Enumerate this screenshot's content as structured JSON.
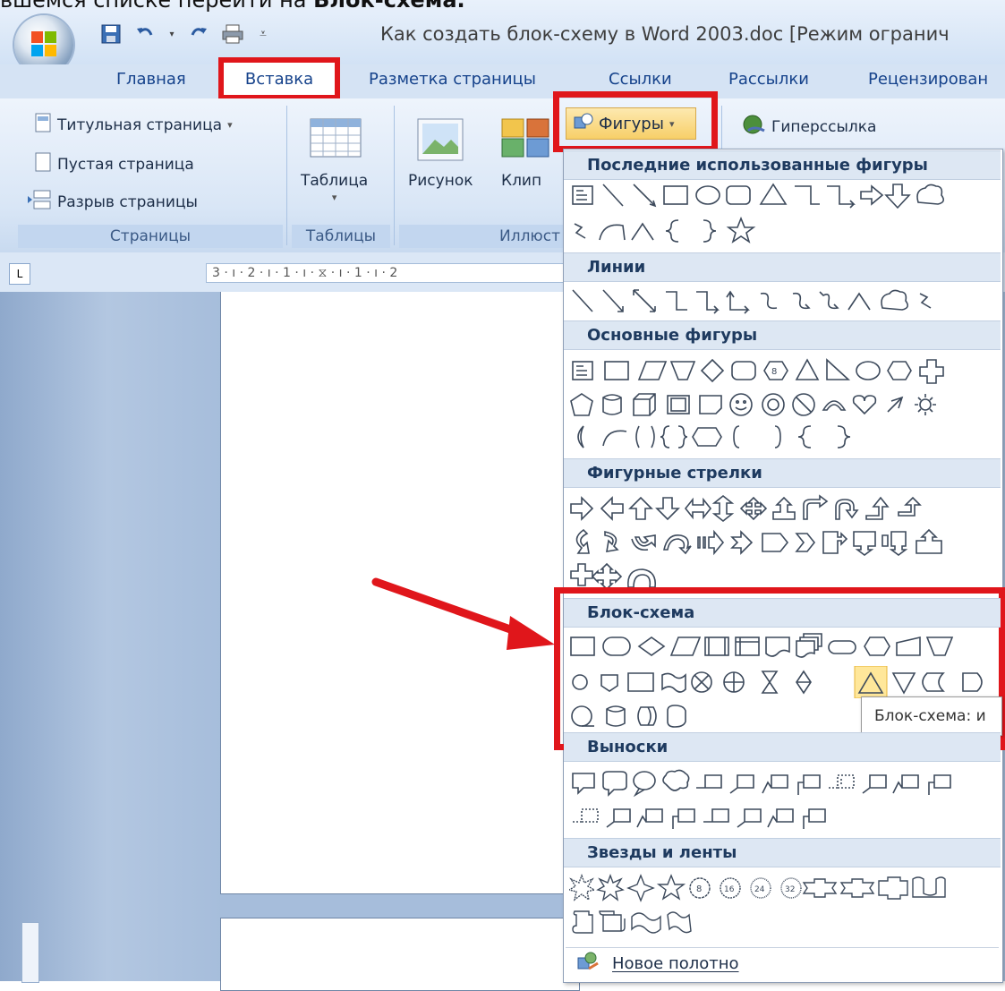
{
  "caption": {
    "prefix": "вшемся списке перейти на ",
    "bold": "Блок-схема."
  },
  "window": {
    "title": "Как создать блок-схему в Word 2003.doc [Режим огранич"
  },
  "quick_access": [
    "save-icon",
    "undo-icon",
    "redo-icon",
    "print-icon",
    "customize-icon"
  ],
  "tabs": [
    "Главная",
    "Вставка",
    "Разметка страницы",
    "Ссылки",
    "Рассылки",
    "Рецензирован"
  ],
  "ribbon": {
    "pages": {
      "cover": "Титульная страница",
      "blank": "Пустая страница",
      "break": "Разрыв страницы",
      "label": "Страницы"
    },
    "tables": {
      "table": "Таблица",
      "label": "Таблицы"
    },
    "illustrations": {
      "picture": "Рисунок",
      "clip": "Клип",
      "shapes": "Фигуры",
      "label": "Иллюст"
    },
    "links": {
      "hyperlink": "Гиперссылка"
    }
  },
  "ruler": {
    "text": "3 · ı · 2 · ı · 1 · ı · ⧖ · ı · 1 · ı · 2"
  },
  "dropdown": {
    "sections": {
      "recent": "Последние использованные фигуры",
      "lines": "Линии",
      "basic": "Основные фигуры",
      "arrows": "Фигурные стрелки",
      "flowchart": "Блок-схема",
      "callouts": "Выноски",
      "stars": "Звезды и ленты"
    },
    "tooltip": "Блок-схема: и",
    "new_canvas": "Новое полотно"
  },
  "colors": {
    "highlight_red": "#e0161b",
    "accent_blue": "#15428b"
  }
}
